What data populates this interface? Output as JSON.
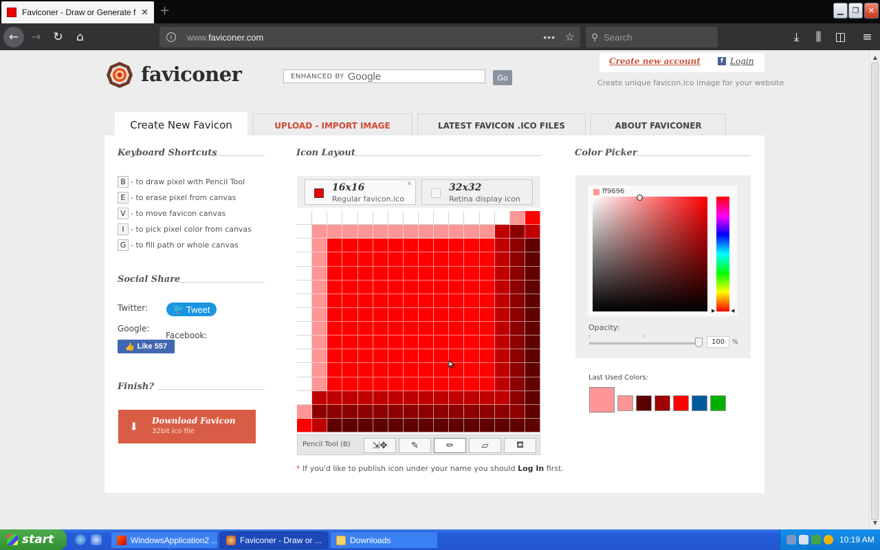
{
  "browser": {
    "tab_title": "Faviconer - Draw or Generate fav",
    "url_prefix": "www.",
    "url_domain": "faviconer.com",
    "search_placeholder": "Search"
  },
  "header": {
    "brand": "faviconer",
    "search_enhanced": "ENHANCED BY",
    "search_brand": "Google",
    "go_label": "Go",
    "create_account": "Create new account",
    "login": "Login",
    "tagline": "Create unique favicon.ico image for your website"
  },
  "tabs": [
    {
      "label": "Create New Favicon"
    },
    {
      "label": "UPLOAD - IMPORT IMAGE"
    },
    {
      "label": "LATEST FAVICON .ICO FILES"
    },
    {
      "label": "ABOUT FAVICONER"
    }
  ],
  "shortcuts": {
    "title": "Keyboard Shortcuts",
    "items": [
      {
        "key": "B",
        "text": "- to draw pixel with Pencil Tool"
      },
      {
        "key": "E",
        "text": "- to erase pixel from canvas"
      },
      {
        "key": "V",
        "text": "- to move favicon canvas"
      },
      {
        "key": "I",
        "text": "- to pick pixel color from canvas"
      },
      {
        "key": "G",
        "text": "- to fill path or whole canvas"
      }
    ]
  },
  "social": {
    "title": "Social Share",
    "twitter_label": "Twitter:",
    "tweet": "Tweet",
    "google_label": "Google:",
    "facebook_label": "Facebook:",
    "like": "Like 557"
  },
  "finish": {
    "title": "Finish?",
    "download_label": "Download Favicon",
    "download_sub": "32bit ico file"
  },
  "icon_layout": {
    "title": "Icon Layout",
    "size16_title": "16x16",
    "size16_sub": "Regular favicon.ico",
    "size32_title": "32x32",
    "size32_sub": "Retina display icon",
    "tool_label": "Pencil Tool (B)",
    "tools": [
      "move-tool",
      "eyedropper-tool",
      "pencil-tool",
      "eraser-tool",
      "fill-tool"
    ],
    "selected_tool": "pencil-tool",
    "note_star": "*",
    "note_pre": " If you'd like to publish icon under your name you should ",
    "note_link": "Log In",
    "note_post": " first.",
    "canvas_colors": {
      "white": "#ffffff",
      "light": "#ff9696",
      "red": "#ff0000",
      "dark": "#c00000",
      "darker": "#8c0000",
      "darkest": "#600000"
    }
  },
  "color_picker": {
    "title": "Color Picker",
    "hex": "ff9696",
    "current_color": "#ff9696",
    "opacity_label": "Opacity:",
    "opacity": "100",
    "opacity_unit": "%",
    "last_used_label": "Last Used Colors:",
    "last_used": [
      "#ff9696",
      "#ff9696",
      "#5c0000",
      "#a00000",
      "#ff0000",
      "#005a9c",
      "#00b000"
    ]
  },
  "taskbar": {
    "start": "start",
    "tasks": [
      "WindowsApplication2 ...",
      "Faviconer - Draw or ...",
      "Downloads"
    ],
    "clock": "10:19 AM"
  }
}
